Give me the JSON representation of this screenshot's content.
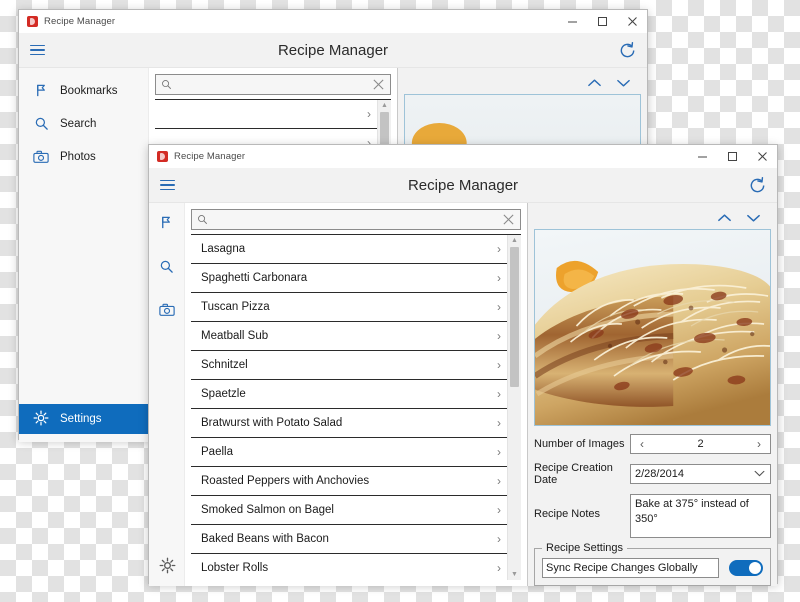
{
  "back_window": {
    "titlebar": {
      "app_name": "Recipe Manager",
      "minimize": "─",
      "maximize": "☐",
      "close": "✕"
    },
    "appbar": {
      "title": "Recipe Manager",
      "menu_icon": "hamburger-icon",
      "refresh_icon": "refresh-icon"
    },
    "nav": {
      "items": [
        {
          "label": "Bookmarks",
          "icon": "flag-icon"
        },
        {
          "label": "Search",
          "icon": "search-icon"
        },
        {
          "label": "Photos",
          "icon": "camera-icon"
        }
      ],
      "settings": {
        "label": "Settings",
        "icon": "gear-icon",
        "selected": true
      }
    },
    "search": {
      "value": "",
      "placeholder": "",
      "clear_label": "✕"
    },
    "list": {
      "items": [
        "",
        "",
        ""
      ],
      "chevron": "›"
    },
    "detail": {
      "up": "⌃",
      "down": "⌄"
    }
  },
  "front_window": {
    "titlebar": {
      "app_name": "Recipe Manager",
      "minimize": "─",
      "maximize": "☐",
      "close": "✕"
    },
    "appbar": {
      "title": "Recipe Manager",
      "menu_icon": "hamburger-icon",
      "refresh_icon": "refresh-icon"
    },
    "nav_rail": {
      "icons": [
        "flag-icon",
        "search-icon",
        "camera-icon"
      ],
      "settings_icon": "gear-icon"
    },
    "search": {
      "value": "",
      "placeholder": "",
      "clear_label": "✕"
    },
    "list": {
      "chevron": "›",
      "items": [
        "Lasagna",
        "Spaghetti Carbonara",
        "Tuscan Pizza",
        "Meatball Sub",
        "Schnitzel",
        "Spaetzle",
        "Bratwurst with Potato Salad",
        "Paella",
        "Roasted Peppers with Anchovies",
        "Smoked Salmon on Bagel",
        "Baked Beans with Bacon",
        "Lobster Rolls"
      ],
      "scroll_up": "▲",
      "scroll_down": "▼"
    },
    "detail": {
      "image_up": "⌃",
      "image_down": "⌄",
      "photo_alt": "lasagna-photo",
      "fields": {
        "number_of_images": {
          "label": "Number of Images",
          "value": "2",
          "prev": "‹",
          "next": "›"
        },
        "creation_date": {
          "label": "Recipe Creation Date",
          "value": "2/28/2014",
          "dropdown": "⌄"
        },
        "notes": {
          "label": "Recipe Notes",
          "value": "Bake at 375° instead of 350°"
        }
      },
      "settings_group": {
        "title": "Recipe Settings",
        "sync_label": "Sync Recipe Changes Globally",
        "sync_enabled": true
      }
    }
  },
  "colors": {
    "accent_blue": "#0f6cbd",
    "icon_blue": "#2a6cb5",
    "app_icon_red": "#d32b24",
    "window_bg": "#ffffff",
    "panel_bg": "#f2f2f2",
    "nav_bg": "#f7f7f7"
  }
}
